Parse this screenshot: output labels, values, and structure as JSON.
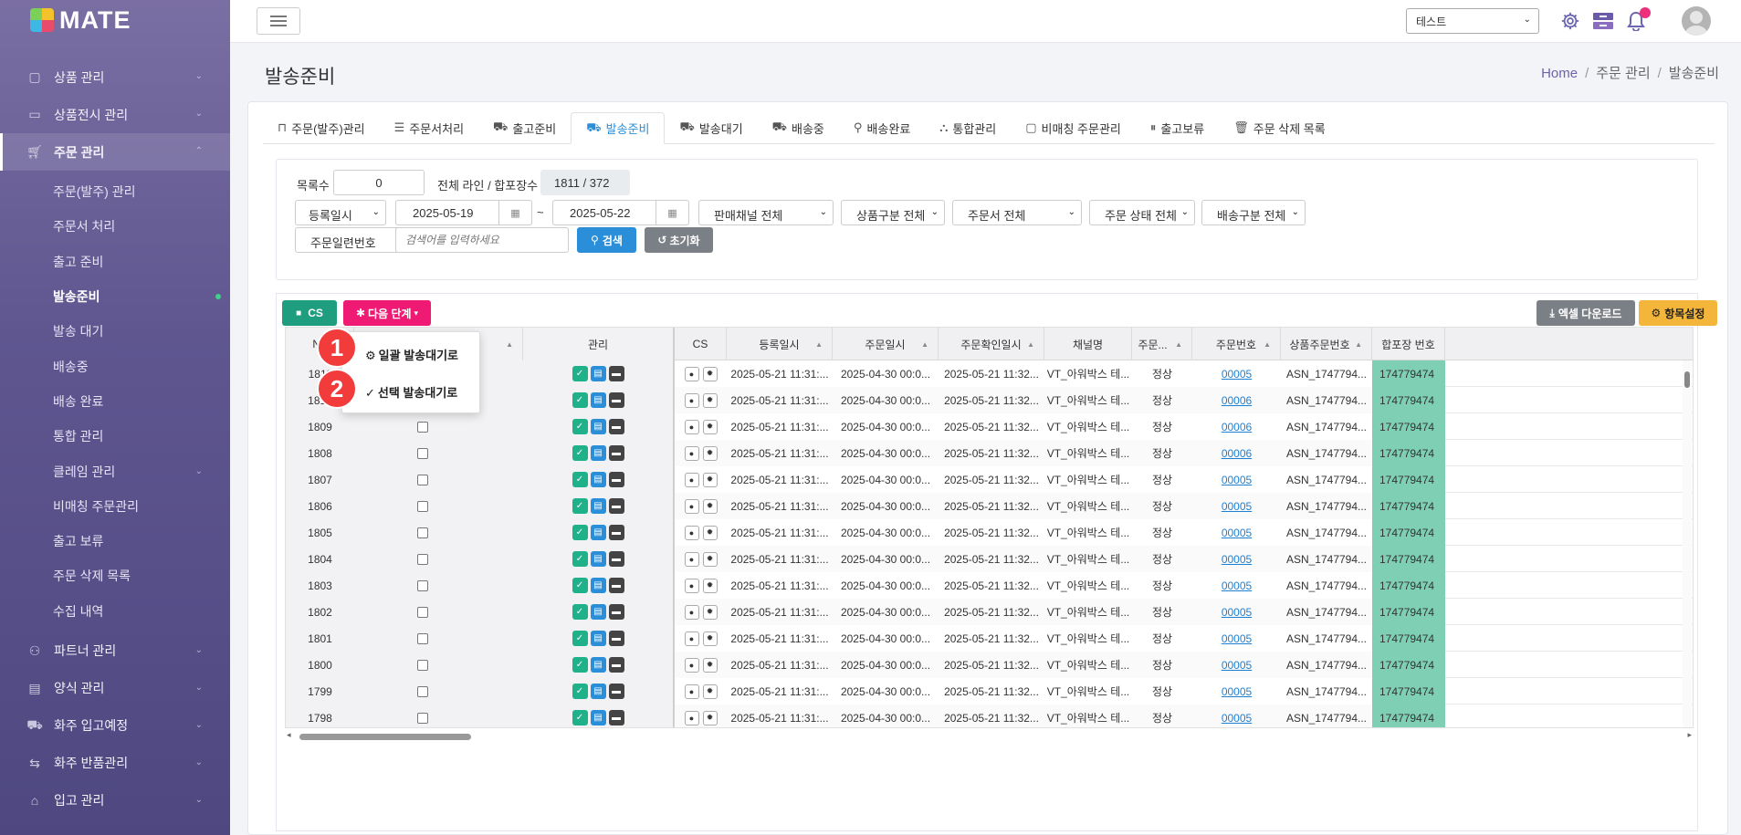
{
  "brand": {
    "logo_text": "MATE"
  },
  "sidebar": {
    "top_items": [
      {
        "label": "상품 관리",
        "icon": "box-icon"
      },
      {
        "label": "상품전시 관리",
        "icon": "display-icon"
      },
      {
        "label": "주문 관리",
        "icon": "cart-icon"
      }
    ],
    "sub_items": [
      {
        "label": "주문(발주) 관리"
      },
      {
        "label": "주문서 처리"
      },
      {
        "label": "출고 준비"
      },
      {
        "label": "발송준비"
      },
      {
        "label": "발송 대기"
      },
      {
        "label": "배송중"
      },
      {
        "label": "배송 완료"
      },
      {
        "label": "통합 관리"
      },
      {
        "label": "클레임 관리"
      },
      {
        "label": "비매칭 주문관리"
      },
      {
        "label": "출고 보류"
      },
      {
        "label": "주문 삭제 목록"
      },
      {
        "label": "수집 내역"
      }
    ],
    "bottom_items": [
      {
        "label": "파트너 관리",
        "icon": "handshake-icon"
      },
      {
        "label": "양식 관리",
        "icon": "form-icon"
      },
      {
        "label": "화주 입고예정",
        "icon": "inbound-icon"
      },
      {
        "label": "화주 반품관리",
        "icon": "return-icon"
      },
      {
        "label": "입고 관리",
        "icon": "warehouse-icon"
      }
    ]
  },
  "topbar": {
    "selector_value": "테스트"
  },
  "page": {
    "title": "발송준비"
  },
  "breadcrumb": {
    "home": "Home",
    "level1": "주문 관리",
    "level2": "발송준비"
  },
  "tabs": [
    {
      "label": "주문(발주)관리",
      "icon": "bag-icon"
    },
    {
      "label": "주문서처리",
      "icon": "checklist-icon"
    },
    {
      "label": "출고준비",
      "icon": "dolly-icon"
    },
    {
      "label": "발송준비",
      "icon": "truck-fast-icon"
    },
    {
      "label": "발송대기",
      "icon": "truck-icon"
    },
    {
      "label": "배송중",
      "icon": "truck-moving-icon"
    },
    {
      "label": "배송완료",
      "icon": "person-box-icon"
    },
    {
      "label": "통합관리",
      "icon": "boxes-icon"
    },
    {
      "label": "비매칭 주문관리",
      "icon": "box-open-icon"
    },
    {
      "label": "출고보류",
      "icon": "pause-icon"
    },
    {
      "label": "주문 삭제 목록",
      "icon": "trash-icon"
    }
  ],
  "filter": {
    "count_label": "목록수",
    "count_value": "0",
    "total_label": "전체 라인 / 합포장수",
    "total_value": "1811 / 372",
    "date_type": "등록일시",
    "date_from": "2025-05-19",
    "tilde": "~",
    "date_to": "2025-05-22",
    "channel": "판매채널 전체",
    "product_type": "상품구분 전체",
    "order_doc": "주문서 전체",
    "order_status": "주문 상태 전체",
    "delivery_type": "배송구분 전체",
    "search_field": "주문일련번호",
    "search_placeholder": "검색어를 입력하세요",
    "search_btn": "검색",
    "reset_btn": "초기화"
  },
  "toolbar": {
    "cs_btn": "CS",
    "next_btn": "다음 단계",
    "excel_btn": "엑셀 다운로드",
    "columns_btn": "항목설정"
  },
  "dropdown": {
    "item1": "일괄 발송대기로",
    "item2": "선택 발송대기로",
    "marker1": "1",
    "marker2": "2"
  },
  "grid": {
    "headers": {
      "no": "No",
      "manage": "관리",
      "cs": "CS",
      "reg": "등록일시",
      "order_date": "주문일시",
      "confirm": "주문확인일시",
      "channel": "채널명",
      "status": "주문...",
      "order_no": "주문번호",
      "product_no": "상품주문번호",
      "hap": "합포장 번호"
    },
    "rows": [
      {
        "no": "1811",
        "order_no": "00005"
      },
      {
        "no": "1810",
        "order_no": "00006"
      },
      {
        "no": "1809",
        "order_no": "00006"
      },
      {
        "no": "1808",
        "order_no": "00006"
      },
      {
        "no": "1807",
        "order_no": "00005"
      },
      {
        "no": "1806",
        "order_no": "00005"
      },
      {
        "no": "1805",
        "order_no": "00005"
      },
      {
        "no": "1804",
        "order_no": "00005"
      },
      {
        "no": "1803",
        "order_no": "00005"
      },
      {
        "no": "1802",
        "order_no": "00005"
      },
      {
        "no": "1801",
        "order_no": "00005"
      },
      {
        "no": "1800",
        "order_no": "00005"
      },
      {
        "no": "1799",
        "order_no": "00005"
      },
      {
        "no": "1798",
        "order_no": "00005"
      }
    ],
    "common": {
      "reg": "2025-05-21 11:31:...",
      "order_date": "2025-04-30 00:0...",
      "confirm": "2025-05-21 11:32...",
      "channel": "VT_아워박스 테...",
      "status": "정상",
      "product_no": "ASN_1747794...",
      "hap": "174779474"
    }
  },
  "colors": {
    "sidebar": "#5f5690",
    "accent_blue": "#2a8fd8",
    "cs_green": "#1f9e7f",
    "next_pink": "#ee1a74",
    "excel_gray": "#7b7f86",
    "columns_yellow": "#f4b63a",
    "marker_red": "#f23b3b",
    "hap_teal": "#7fcfb4"
  }
}
